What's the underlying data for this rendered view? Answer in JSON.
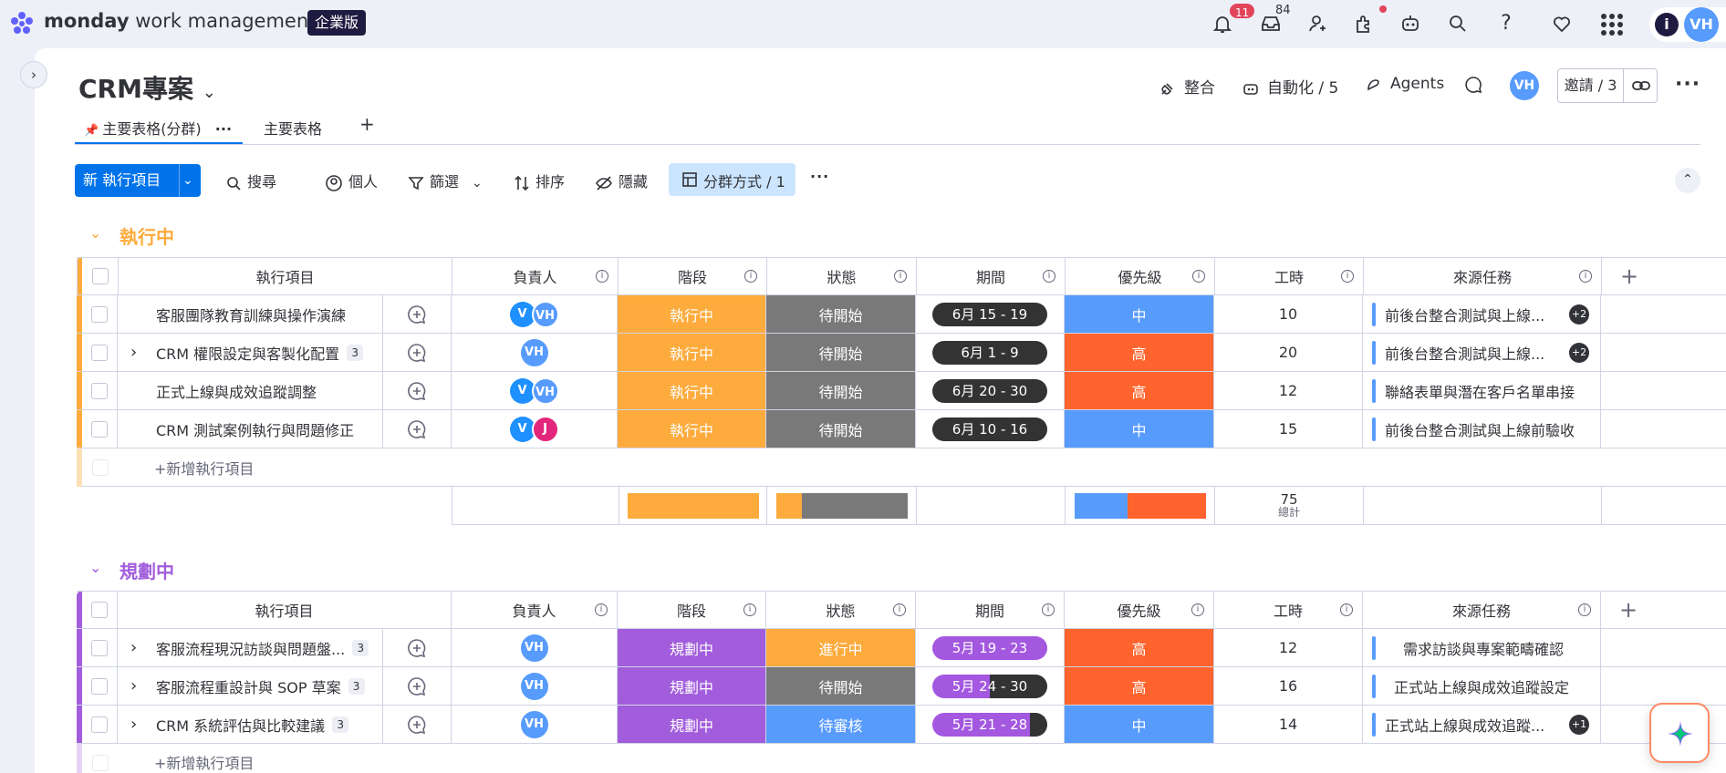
{
  "app": {
    "brand_bold": "monday",
    "brand_rest": " work management",
    "edition": "企業版",
    "notifications_count": "11",
    "inbox_count": "84",
    "user_initials": "VH"
  },
  "colors": {
    "accent": "#0073ea",
    "working": "#fdab3d",
    "stuck_gray": "#797979",
    "planning": "#a25ddc",
    "high": "#ff642e",
    "medium": "#579bfc",
    "dark": "#333333",
    "planning_pill": "#a358df"
  },
  "board": {
    "title": "CRM專案",
    "integrate": "整合",
    "automation": "自動化 / 5",
    "agents": "Agents",
    "invite": "邀請 / 3"
  },
  "tabs": [
    {
      "label": "主要表格(分群)"
    },
    {
      "label": "主要表格"
    }
  ],
  "toolbar": {
    "new_item": "新 執行項目",
    "search": "搜尋",
    "person": "個人",
    "filter": "篩選",
    "sort": "排序",
    "hide": "隱藏",
    "group_by": "分群方式 / 1"
  },
  "columns": {
    "item": "執行項目",
    "owner": "負責人",
    "stage": "階段",
    "status": "狀態",
    "period": "期間",
    "priority": "優先級",
    "hours": "工時",
    "source": "來源任務"
  },
  "groups": [
    {
      "title": "執行中",
      "add_item": "+新增執行項目",
      "sum_hours": "75",
      "sum_label": "總計",
      "rows": [
        {
          "name": "客服團隊教育訓練與操作演練",
          "subitems": "",
          "owners": [
            "V",
            "VH"
          ],
          "stage": "執行中",
          "status": "待開始",
          "period": "6月 15 - 19",
          "priority": "中",
          "hours": "10",
          "source": "前後台整合測試與上線...",
          "source_more": "+2"
        },
        {
          "name": "CRM 權限設定與客製化配置",
          "subitems": "3",
          "owners": [
            "VH"
          ],
          "stage": "執行中",
          "status": "待開始",
          "period": "6月 1 - 9",
          "priority": "高",
          "hours": "20",
          "source": "前後台整合測試與上線...",
          "source_more": "+2"
        },
        {
          "name": "正式上線與成效追蹤調整",
          "subitems": "",
          "owners": [
            "V",
            "VH"
          ],
          "stage": "執行中",
          "status": "待開始",
          "period": "6月 20 - 30",
          "priority": "高",
          "hours": "12",
          "source": "聯絡表單與潛在客戶名單串接",
          "source_more": ""
        },
        {
          "name": "CRM 測試案例執行與問題修正",
          "subitems": "",
          "owners": [
            "V",
            "J"
          ],
          "stage": "執行中",
          "status": "待開始",
          "period": "6月 10 - 16",
          "priority": "中",
          "hours": "15",
          "source": "前後台整合測試與上線前驗收",
          "source_more": ""
        }
      ]
    },
    {
      "title": "規劃中",
      "add_item": "+新增執行項目",
      "rows": [
        {
          "name": "客服流程現況訪談與問題盤...",
          "subitems": "3",
          "owners": [
            "VH"
          ],
          "stage": "規劃中",
          "status": "進行中",
          "period": "5月 19 - 23",
          "priority": "高",
          "hours": "12",
          "source": "需求訪談與專案範疇確認",
          "source_more": ""
        },
        {
          "name": "客服流程重設計與 SOP 草案",
          "subitems": "3",
          "owners": [
            "VH"
          ],
          "stage": "規劃中",
          "status": "待開始",
          "period": "5月 24 - 30",
          "priority": "高",
          "hours": "16",
          "source": "正式站上線與成效追蹤設定",
          "source_more": ""
        },
        {
          "name": "CRM 系統評估與比較建議",
          "subitems": "3",
          "owners": [
            "VH"
          ],
          "stage": "規劃中",
          "status": "待審核",
          "period": "5月 21 - 28",
          "priority": "中",
          "hours": "14",
          "source": "正式站上線與成效追蹤...",
          "source_more": "+1"
        }
      ]
    }
  ]
}
